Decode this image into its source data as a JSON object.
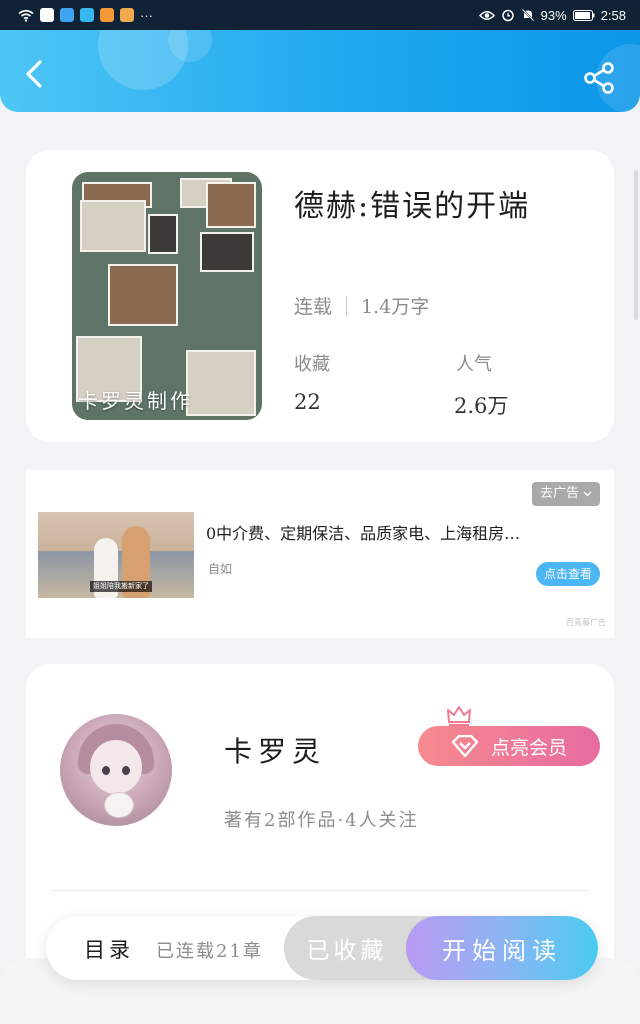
{
  "status_bar": {
    "battery": "93%",
    "time": "2:58"
  },
  "book": {
    "title": "德赫:错误的开端",
    "status": "连载",
    "word_count": "1.4万字",
    "cover_caption": "卡罗灵制作",
    "favorites_label": "收藏",
    "favorites_value": "22",
    "popularity_label": "人气",
    "popularity_value": "2.6万"
  },
  "ad": {
    "close_label": "去广告",
    "text": "0中介费、定期保洁、品质家电、上海租房…",
    "source": "自如",
    "cta": "点击查看",
    "thumb_caption": "姐姐陪我搬新家了",
    "footnote": "百青藤广告"
  },
  "author": {
    "name": "卡罗灵",
    "meta": "著有2部作品·4人关注",
    "vip_button": "点亮会员"
  },
  "bottom_bar": {
    "toc": "目录",
    "chapters": "已连载21章",
    "favorited": "已收藏",
    "start_reading": "开始阅读"
  },
  "colors": {
    "header_start": "#4ec6f5",
    "header_end": "#0c96e8",
    "vip_start": "#f78a8e",
    "vip_end": "#e76ba1",
    "read_start": "#b99af3",
    "read_end": "#49cbf2",
    "ad_cta": "#4cb6f4"
  },
  "icons": {
    "back": "chevron-left-icon",
    "share": "share-icon",
    "crown": "crown-icon",
    "diamond": "diamond-icon"
  }
}
